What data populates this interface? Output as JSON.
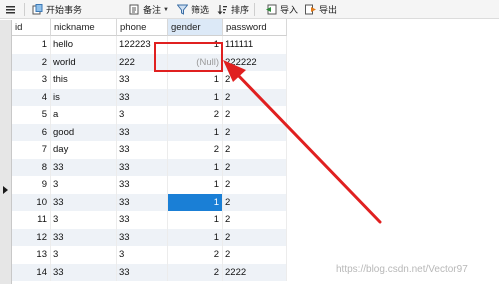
{
  "toolbar": {
    "menu_label": "",
    "begin_transaction": "开始事务",
    "memo": "备注",
    "filter": "筛选",
    "sort": "排序",
    "import": "导入",
    "export": "导出"
  },
  "columns": [
    "id",
    "nickname",
    "phone",
    "gender",
    "password"
  ],
  "rows": [
    {
      "id": "1",
      "nickname": "hello",
      "phone": "122223",
      "gender": "1",
      "password": "111111"
    },
    {
      "id": "2",
      "nickname": "world",
      "phone": "222",
      "gender": "(Null)",
      "password": "222222"
    },
    {
      "id": "3",
      "nickname": "this",
      "phone": "33",
      "gender": "1",
      "password": "2"
    },
    {
      "id": "4",
      "nickname": "is",
      "phone": "33",
      "gender": "1",
      "password": "2"
    },
    {
      "id": "5",
      "nickname": "a",
      "phone": "3",
      "gender": "2",
      "password": "2"
    },
    {
      "id": "6",
      "nickname": "good",
      "phone": "33",
      "gender": "1",
      "password": "2"
    },
    {
      "id": "7",
      "nickname": "day",
      "phone": "33",
      "gender": "2",
      "password": "2"
    },
    {
      "id": "8",
      "nickname": "33",
      "phone": "33",
      "gender": "1",
      "password": "2"
    },
    {
      "id": "9",
      "nickname": "3",
      "phone": "33",
      "gender": "1",
      "password": "2"
    },
    {
      "id": "10",
      "nickname": "33",
      "phone": "33",
      "gender": "1",
      "password": "2"
    },
    {
      "id": "11",
      "nickname": "3",
      "phone": "33",
      "gender": "1",
      "password": "2"
    },
    {
      "id": "12",
      "nickname": "33",
      "phone": "33",
      "gender": "1",
      "password": "2"
    },
    {
      "id": "13",
      "nickname": "3",
      "phone": "3",
      "gender": "2",
      "password": "2"
    },
    {
      "id": "14",
      "nickname": "33",
      "phone": "33",
      "gender": "2",
      "password": "2222"
    }
  ],
  "selected_row_id": "10",
  "watermark": "https://blog.csdn.net/Vector97",
  "colors": {
    "selection": "#1a7fd6",
    "annotation": "#e02020",
    "null_text": "#9a9a9a"
  }
}
